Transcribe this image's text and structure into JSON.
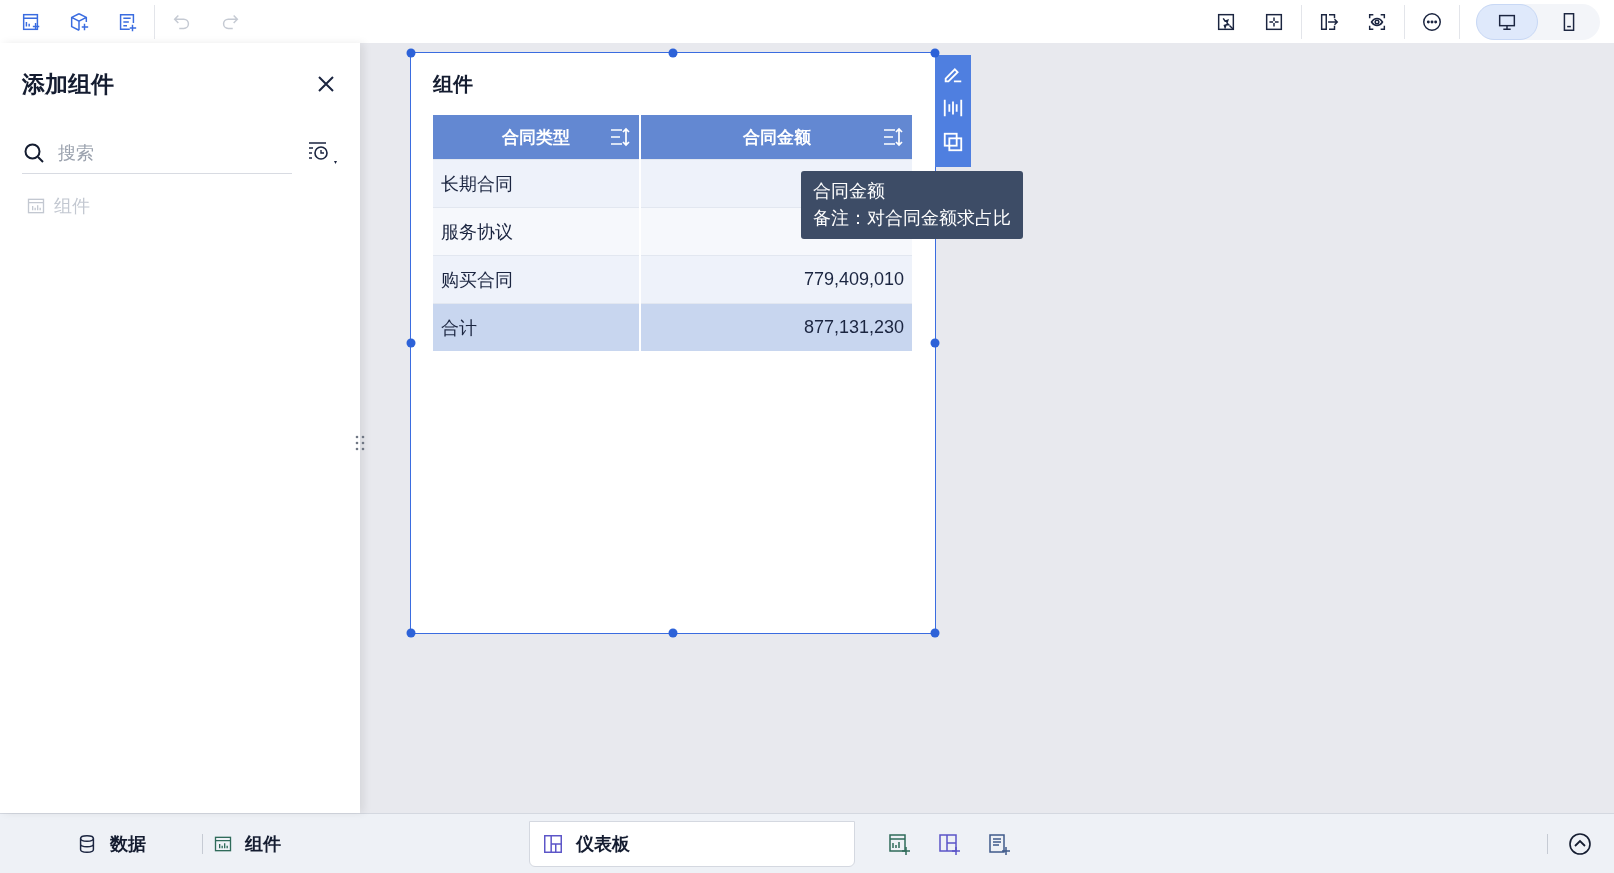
{
  "view_modes": [
    {
      "kind": "desktop",
      "selected": true
    },
    {
      "kind": "mobile",
      "selected": false
    }
  ],
  "panel": {
    "title": "添加组件",
    "search": {
      "placeholder": "搜索"
    },
    "items": [
      {
        "label": "组件",
        "disabled": true
      }
    ]
  },
  "card": {
    "title": "组件",
    "columns": [
      {
        "label": "合同类型"
      },
      {
        "label": "合同金额"
      }
    ],
    "rows": [
      {
        "type": "长期合同"
      },
      {
        "type": "服务协议"
      },
      {
        "type": "购买合同",
        "amount": "779,409,010"
      }
    ],
    "total": {
      "label": "合计",
      "amount": "877,131,230"
    },
    "tooltip": {
      "title": "合同金额",
      "note": "备注：对合同金额求占比"
    }
  },
  "bottom_tabs": [
    {
      "kind": "data",
      "label": "数据",
      "selected": false
    },
    {
      "kind": "widget",
      "label": "组件",
      "selected": false
    },
    {
      "kind": "dashboard",
      "label": "仪表板",
      "selected": true
    }
  ]
}
